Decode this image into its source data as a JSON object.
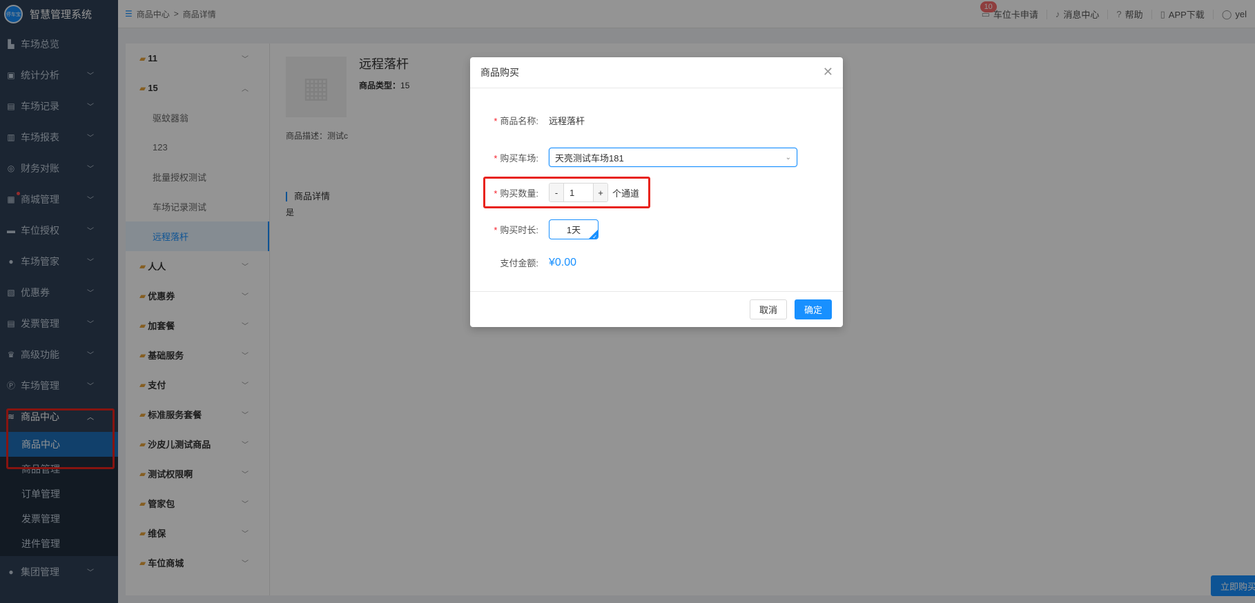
{
  "app": {
    "title": "智慧管理系统",
    "logo_text": "停车宝"
  },
  "breadcrumb": [
    "商品中心",
    "商品详情"
  ],
  "header_right": [
    {
      "label": "车位卡申请",
      "icon": "card-icon",
      "badge": "10"
    },
    {
      "label": "消息中心",
      "icon": "bell-icon"
    },
    {
      "label": "帮助",
      "icon": "help-icon"
    },
    {
      "label": "APP下载",
      "icon": "phone-icon"
    },
    {
      "label": "yel",
      "icon": "user-icon"
    }
  ],
  "sidebar": {
    "items": [
      {
        "label": "车场总览",
        "icon": "dashboard-icon"
      },
      {
        "label": "统计分析",
        "icon": "chart-icon"
      },
      {
        "label": "车场记录",
        "icon": "record-icon"
      },
      {
        "label": "车场报表",
        "icon": "report-icon"
      },
      {
        "label": "财务对账",
        "icon": "finance-icon"
      },
      {
        "label": "商城管理",
        "icon": "store-icon"
      },
      {
        "label": "车位授权",
        "icon": "car-icon"
      },
      {
        "label": "车场管家",
        "icon": "person-icon"
      },
      {
        "label": "优惠券",
        "icon": "coupon-icon"
      },
      {
        "label": "发票管理",
        "icon": "invoice-icon"
      },
      {
        "label": "高级功能",
        "icon": "crown-icon"
      },
      {
        "label": "车场管理",
        "icon": "parking-icon"
      },
      {
        "label": "商品中心",
        "icon": "layers-icon"
      }
    ],
    "sub_items": [
      "商品中心",
      "商品管理",
      "订单管理",
      "发票管理",
      "进件管理"
    ],
    "last_item": {
      "label": "集团管理",
      "icon": "group-icon"
    }
  },
  "catalog": {
    "categories_top": [
      {
        "label": "11"
      },
      {
        "label": "15"
      }
    ],
    "sub_items": [
      "驱蚊器翁",
      "123",
      "批量授权测试",
      "车场记录测试",
      "远程落杆"
    ],
    "categories_bottom": [
      "人人",
      "优惠券",
      "加套餐",
      "基础服务",
      "支付",
      "标准服务套餐",
      "沙皮儿测试商品",
      "测试权限啊",
      "管家包",
      "维保",
      "车位商城"
    ]
  },
  "product": {
    "title": "远程落杆",
    "type_label": "商品类型：",
    "type_value": "15",
    "desc": "商品描述：测试c",
    "detail_section": "商品详情",
    "detail_value": "是"
  },
  "buy_now_label": "立即购买",
  "modal": {
    "title": "商品购买",
    "name_label": "商品名称:",
    "name_value": "远程落杆",
    "lot_label": "购买车场:",
    "lot_value": "天亮测试车场181",
    "qty_label": "购买数量:",
    "qty_minus": "-",
    "qty_value": "1",
    "qty_plus": "+",
    "qty_unit": "个通道",
    "duration_label": "购买时长:",
    "duration_value": "1天",
    "pay_label": "支付金额:",
    "pay_value": "¥0.00",
    "cancel_label": "取消",
    "ok_label": "确定"
  },
  "colors": {
    "primary": "#1890ff",
    "sidebar": "#304156",
    "highlight": "#e8231c"
  }
}
